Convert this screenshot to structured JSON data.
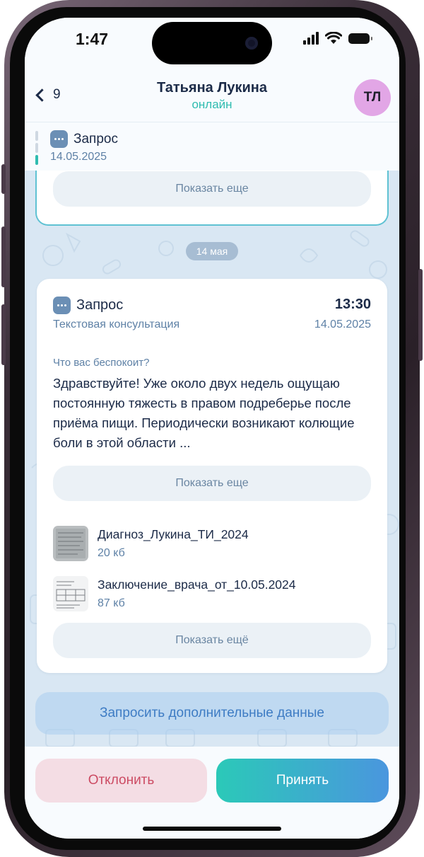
{
  "status_bar": {
    "time": "1:47",
    "icons": [
      "cellular-signal-icon",
      "wifi-icon",
      "battery-icon"
    ]
  },
  "header": {
    "back_count": "9",
    "contact_name": "Татьяна Лукина",
    "contact_status": "онлайн",
    "avatar_initials": "ТЛ"
  },
  "pinned": {
    "title": "Запрос",
    "date": "14.05.2025"
  },
  "chat": {
    "previous_card": {
      "show_more_label": "Показать еще"
    },
    "date_separator": "14 мая",
    "request_card": {
      "title": "Запрос",
      "time": "13:30",
      "type": "Текстовая консультация",
      "date": "14.05.2025",
      "question_label": "Что вас беспокоит?",
      "question_text": "Здравствуйте! Уже около двух недель ощущаю постоянную тяжесть в правом подреберье после приёма пищи. Периодически возникают колющие боли в этой области ...",
      "show_more_label": "Показать еще",
      "files": [
        {
          "name": "Диагноз_Лукина_ТИ_2024",
          "size": "20 кб"
        },
        {
          "name": "Заключение_врача_от_10.05.2024",
          "size": "87 кб"
        }
      ],
      "show_more_files_label": "Показать ещё"
    },
    "request_more_label": "Запросить дополнительные данные"
  },
  "actions": {
    "reject_label": "Отклонить",
    "accept_label": "Принять"
  },
  "colors": {
    "accent_teal": "#2fbcb0",
    "text_primary": "#1c2b48",
    "text_secondary": "#5e81a6",
    "reject_text": "#cc4b63",
    "accept_gradient_start": "#2bc9b8",
    "accept_gradient_end": "#4a96de",
    "avatar_bg": "#e2a6e6"
  }
}
